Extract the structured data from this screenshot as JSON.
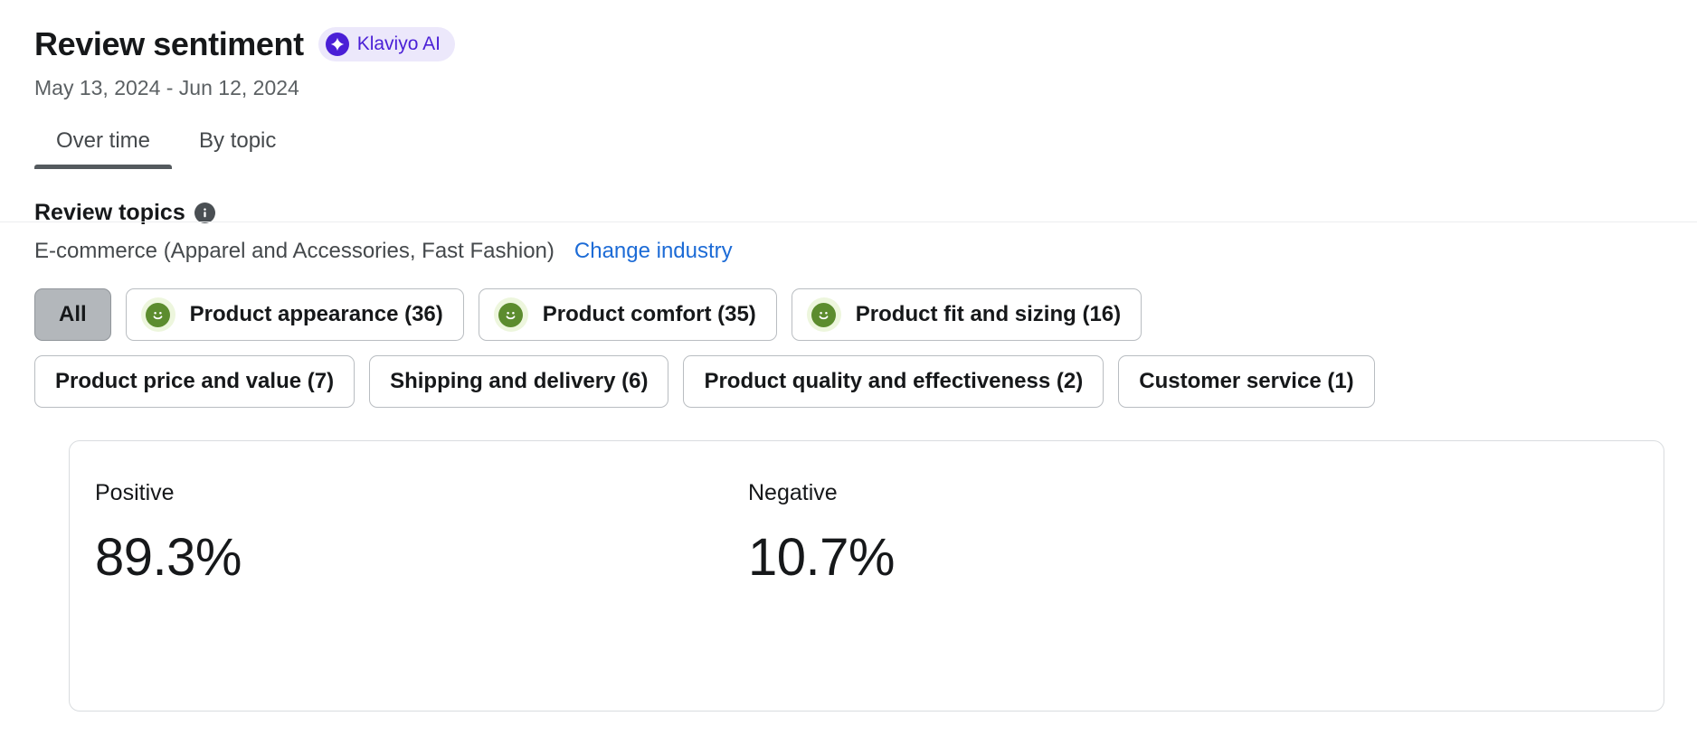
{
  "header": {
    "title": "Review sentiment",
    "ai_badge": {
      "label": "Klaviyo AI",
      "icon": "sparkle-icon",
      "bg_color": "#ece8fb",
      "text_color": "#4a1fd6"
    },
    "date_range": "May 13, 2024 - Jun 12, 2024"
  },
  "tabs": [
    {
      "label": "Over time",
      "active": true
    },
    {
      "label": "By topic",
      "active": false
    }
  ],
  "review_topics": {
    "section_title": "Review topics",
    "info_icon": "info-icon",
    "industry": "E-commerce (Apparel and Accessories, Fast Fashion)",
    "change_industry_link": "Change industry",
    "rows": [
      [
        {
          "label": "All",
          "selected": true,
          "icon": null
        },
        {
          "label": "Product appearance (36)",
          "selected": false,
          "icon": "positive-smiley-icon"
        },
        {
          "label": "Product comfort (35)",
          "selected": false,
          "icon": "positive-smiley-icon"
        },
        {
          "label": "Product fit and sizing (16)",
          "selected": false,
          "icon": "positive-smiley-icon"
        }
      ],
      [
        {
          "label": "Product price and value (7)",
          "selected": false,
          "icon": null
        },
        {
          "label": "Shipping and delivery (6)",
          "selected": false,
          "icon": null
        },
        {
          "label": "Product quality and effectiveness (2)",
          "selected": false,
          "icon": null
        },
        {
          "label": "Customer service (1)",
          "selected": false,
          "icon": null
        }
      ]
    ]
  },
  "sentiment_card": {
    "positive_label": "Positive",
    "positive_value": "89.3%",
    "negative_label": "Negative",
    "negative_value": "10.7%"
  },
  "colors": {
    "accent_purple": "#4a1fd6",
    "link_blue": "#1c6bd6",
    "smiley_green": "#5c8c2e",
    "smiley_halo": "#edf6dd",
    "selected_chip": "#b3b7bb"
  }
}
